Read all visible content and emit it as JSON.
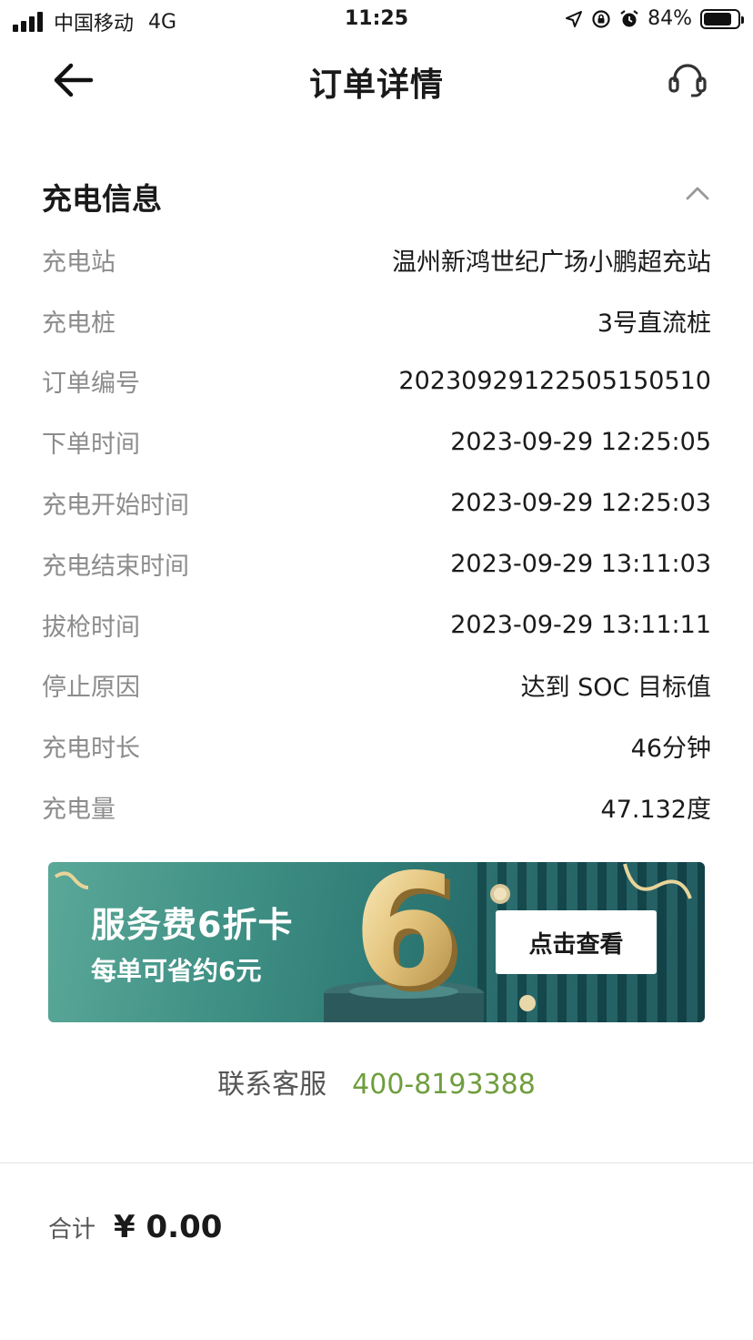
{
  "status_bar": {
    "carrier": "中国移动",
    "network": "4G",
    "time": "11:25",
    "battery": "84%",
    "battery_level": 0.84
  },
  "nav": {
    "title": "订单详情",
    "back_icon": "arrow-left-icon",
    "service_icon": "headset-icon"
  },
  "section": {
    "title": "充电信息",
    "collapse_icon": "chevron-up-icon"
  },
  "info_rows": [
    {
      "label": "充电站",
      "value": "温州新鸿世纪广场小鹏超充站"
    },
    {
      "label": "充电桩",
      "value": "3号直流桩"
    },
    {
      "label": "订单编号",
      "value": "202309291225051505​10"
    },
    {
      "label": "下单时间",
      "value": "2023-09-29 12:25:05"
    },
    {
      "label": "充电开始时间",
      "value": "2023-09-29 12:25:03"
    },
    {
      "label": "充电结束时间",
      "value": "2023-09-29 13:11:03"
    },
    {
      "label": "拔枪时间",
      "value": "2023-09-29 13:11:11"
    },
    {
      "label": "停止原因",
      "value": "达到 SOC 目标值"
    },
    {
      "label": "充电时长",
      "value": "46分钟"
    },
    {
      "label": "充电量",
      "value": "47.132度"
    }
  ],
  "banner": {
    "title": "服务费6折卡",
    "subtitle": "每单可省约6元",
    "digit": "6",
    "button_label": "点击查看"
  },
  "contact": {
    "label": "联系客服",
    "phone": "400-8193388"
  },
  "total": {
    "label": "合计",
    "amount": "¥ 0.00"
  },
  "colors": {
    "accent_green": "#6f9e3e",
    "label_gray": "#8c8c8c",
    "banner_teal": "#2d7773"
  }
}
